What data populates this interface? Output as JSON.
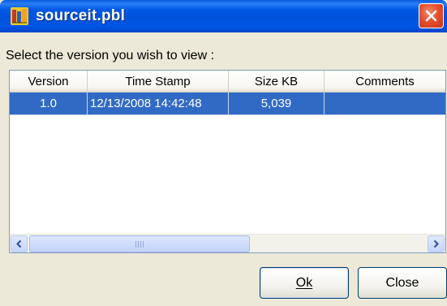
{
  "window": {
    "title": "sourceit.pbl",
    "close_icon": "close-icon",
    "app_icon": "powerbuilder-library-icon"
  },
  "prompt": "Select the version you wish to view :",
  "table": {
    "columns": [
      "Version",
      "Time Stamp",
      "Size KB",
      "Comments"
    ],
    "rows": [
      {
        "version": "1.0",
        "timestamp": "12/13/2008 14:42:48",
        "size_kb": "5,039",
        "comments": "",
        "selected": true
      }
    ]
  },
  "scrollbar": {
    "left_icon": "scroll-left-arrow-icon",
    "right_icon": "scroll-right-arrow-icon"
  },
  "buttons": {
    "ok_label": "Ok",
    "close_label": "Close"
  },
  "colors": {
    "titlebar": "#0055e8",
    "selection": "#316ac5",
    "window_bg": "#ece9d8",
    "close_button": "#e4502d"
  }
}
